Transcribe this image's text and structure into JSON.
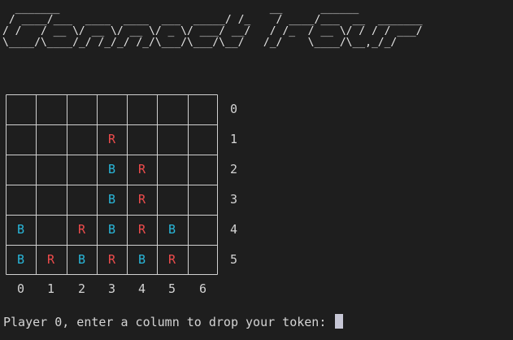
{
  "banner": {
    "title": "Connect Four",
    "ascii_art": "  _______                                 __      ______\n / ____/___  ____  ____  ___  _____/ /_    / ____/___  __  _______\n/ /   / __ \\/ __ \\/ __ \\/ _ \\/ ___/ __/   / /_  / __ \\/ / / / ___/\n\\____/\\____/_/ /_/_/ /_/\\___/\\___/\\__/   /_/    \\____/\\__,_/_/"
  },
  "board": {
    "rows": 6,
    "cols": 7,
    "colors": {
      "R": "#f14c4c",
      "B": "#29b8db",
      "grid": "#d0d0d0"
    },
    "cells": [
      [
        "",
        "",
        "",
        "",
        "",
        "",
        ""
      ],
      [
        "",
        "",
        "",
        "R",
        "",
        "",
        ""
      ],
      [
        "",
        "",
        "",
        "B",
        "R",
        "",
        ""
      ],
      [
        "",
        "",
        "",
        "B",
        "R",
        "",
        ""
      ],
      [
        "B",
        "",
        "R",
        "B",
        "R",
        "B",
        ""
      ],
      [
        "B",
        "R",
        "B",
        "R",
        "B",
        "R",
        ""
      ]
    ],
    "row_labels": [
      "0",
      "1",
      "2",
      "3",
      "4",
      "5"
    ],
    "col_labels": [
      "0",
      "1",
      "2",
      "3",
      "4",
      "5",
      "6"
    ]
  },
  "prompt": {
    "text": "Player 0, enter a column to drop your token:"
  }
}
